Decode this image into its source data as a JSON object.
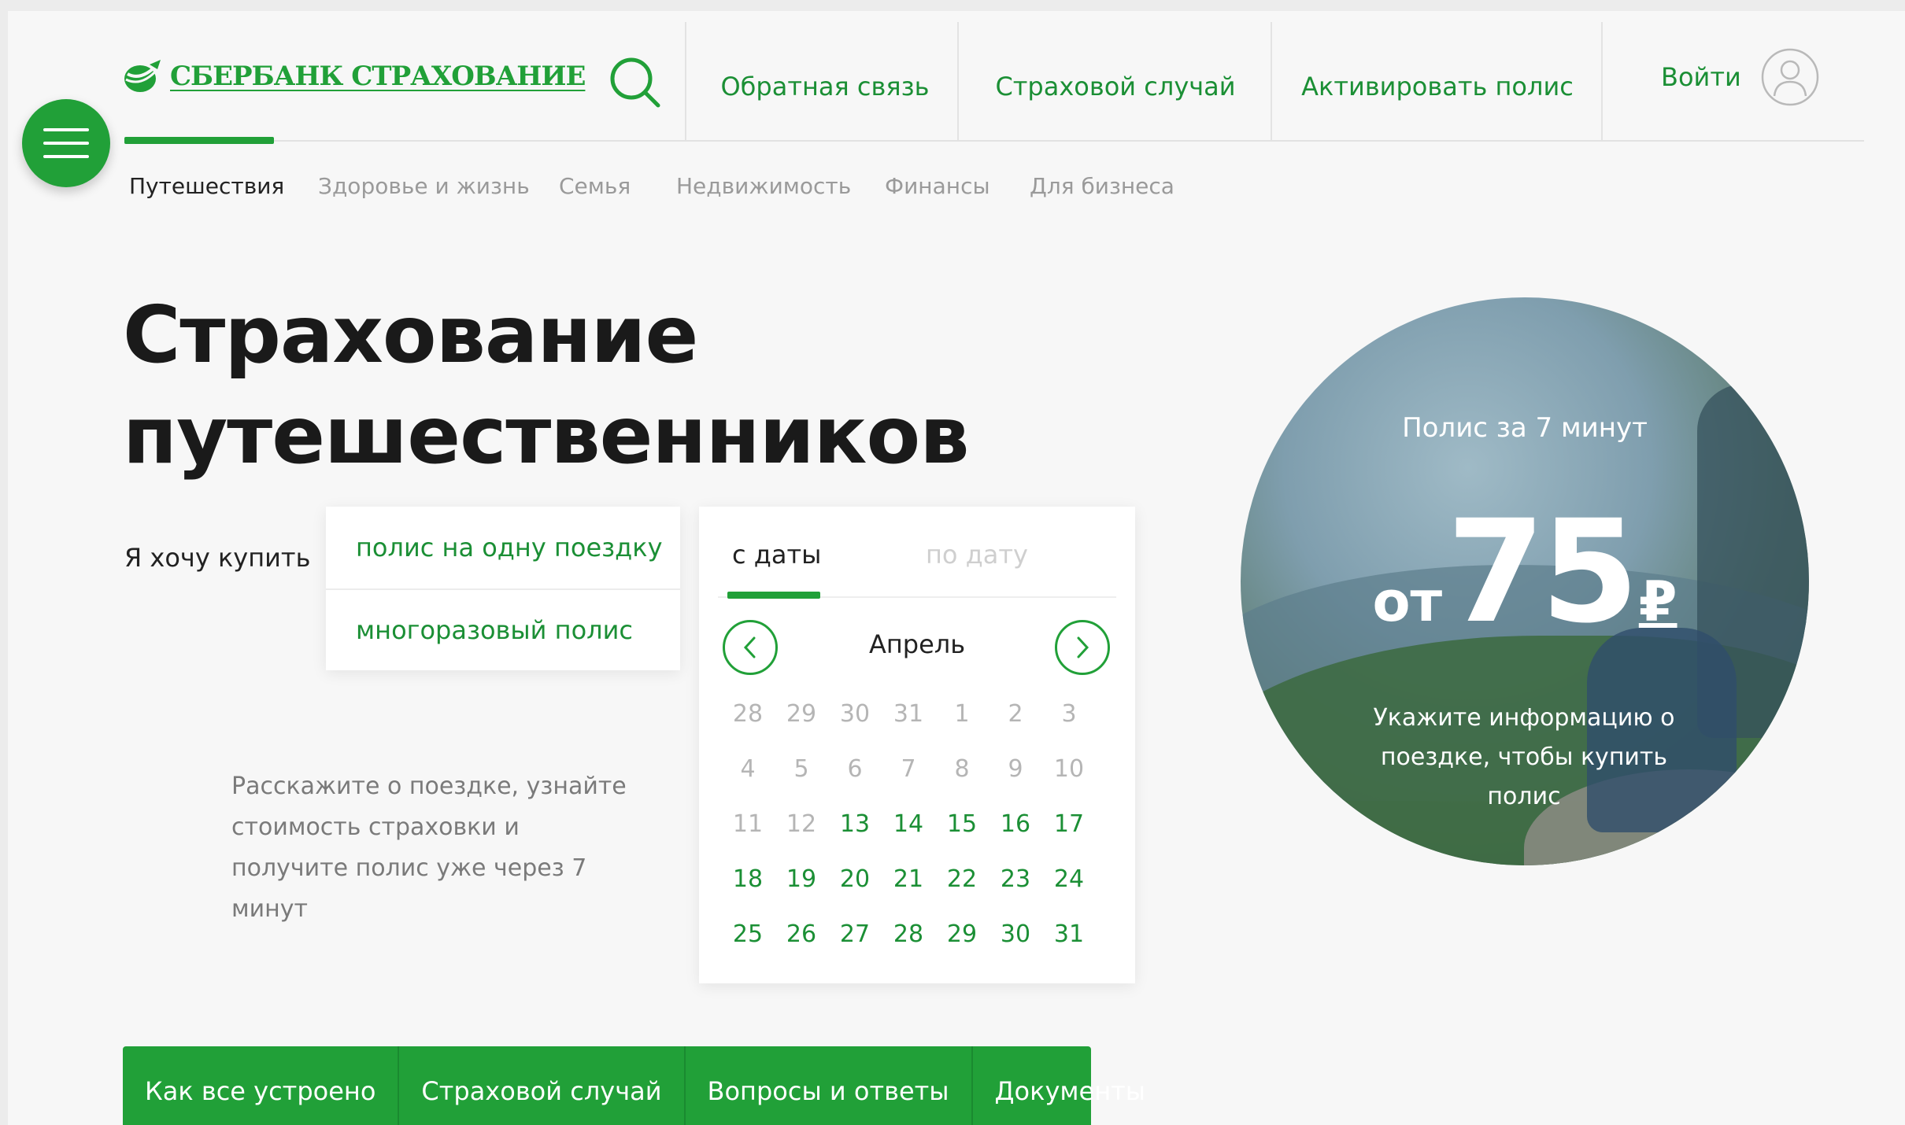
{
  "brand": {
    "name": "СБЕРБАНК СТРАХОВАНИЕ",
    "color": "#21a038"
  },
  "header": {
    "nav": [
      {
        "label": "Обратная связь"
      },
      {
        "label": "Страховой случай"
      },
      {
        "label": "Активировать полис"
      }
    ],
    "login_label": "Войти",
    "icons": [
      "menu-icon",
      "search-icon",
      "user-icon"
    ]
  },
  "categories": [
    {
      "label": "Путешествия",
      "active": true
    },
    {
      "label": "Здоровье и жизнь",
      "active": false
    },
    {
      "label": "Семья",
      "active": false
    },
    {
      "label": "Недвижимость",
      "active": false
    },
    {
      "label": "Финансы",
      "active": false
    },
    {
      "label": "Для бизнеса",
      "active": false
    }
  ],
  "hero": {
    "title_line1": "Страхование",
    "title_line2": "путешественников",
    "want_label": "Я хочу купить",
    "options": [
      "полис на одну поездку",
      "многоразовый полис"
    ],
    "description": "Расскажите о поездке, узнайте стоимость страховки и получите полис уже через 7 минут"
  },
  "calendar": {
    "tab_from": "с даты",
    "tab_to": "по дату",
    "month": "Апрель",
    "days": [
      [
        "28",
        false
      ],
      [
        "29",
        false
      ],
      [
        "30",
        false
      ],
      [
        "31",
        false
      ],
      [
        "1",
        false
      ],
      [
        "2",
        false
      ],
      [
        "3",
        false
      ],
      [
        "4",
        false
      ],
      [
        "5",
        false
      ],
      [
        "6",
        false
      ],
      [
        "7",
        false
      ],
      [
        "8",
        false
      ],
      [
        "9",
        false
      ],
      [
        "10",
        false
      ],
      [
        "11",
        false
      ],
      [
        "12",
        false
      ],
      [
        "13",
        true
      ],
      [
        "14",
        true
      ],
      [
        "15",
        true
      ],
      [
        "16",
        true
      ],
      [
        "17",
        true
      ],
      [
        "18",
        true
      ],
      [
        "19",
        true
      ],
      [
        "20",
        true
      ],
      [
        "21",
        true
      ],
      [
        "22",
        true
      ],
      [
        "23",
        true
      ],
      [
        "24",
        true
      ],
      [
        "25",
        true
      ],
      [
        "26",
        true
      ],
      [
        "27",
        true
      ],
      [
        "28",
        true
      ],
      [
        "29",
        true
      ],
      [
        "30",
        true
      ],
      [
        "31",
        true
      ]
    ]
  },
  "promo": {
    "subtitle": "Полис за 7 минут",
    "price_prefix": "от",
    "price_value": "75",
    "currency": "₽",
    "note": "Укажите информацию о поездке, чтобы купить полис"
  },
  "bottom_nav": [
    {
      "label": "Как все устроено"
    },
    {
      "label": "Страховой случай"
    },
    {
      "label": "Вопросы и ответы"
    },
    {
      "label": "Документы"
    }
  ]
}
